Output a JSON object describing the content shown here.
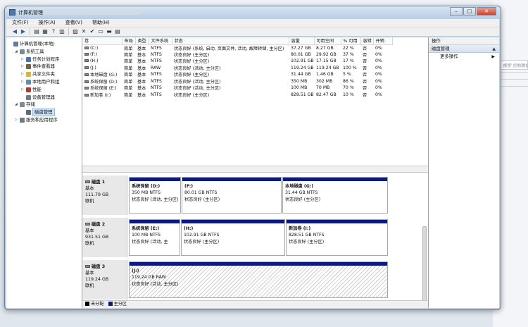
{
  "window": {
    "title": "计算机管理"
  },
  "menu": [
    "文件(F)",
    "操作(A)",
    "查看(V)",
    "帮助(H)"
  ],
  "toolbar_icons": [
    "back-arrow-icon",
    "forward-arrow-icon",
    "folder-up-icon",
    "show-hide-tree-icon",
    "help-icon",
    "properties-icon",
    "delete-icon",
    "check-icon",
    "open-folder-icon",
    "folder-icon",
    "export-list-icon"
  ],
  "tree": [
    {
      "label": "计算机管理(本地)",
      "level": 0,
      "arrow": "",
      "icon": "computer-management-icon",
      "color": "#5b7fa8"
    },
    {
      "label": "系统工具",
      "level": 1,
      "arrow": "▲",
      "icon": "tools-icon",
      "color": "#7a8b8f"
    },
    {
      "label": "任务计划程序",
      "level": 2,
      "arrow": "▸",
      "icon": "clock-icon",
      "color": "#3f77b9"
    },
    {
      "label": "事件查看器",
      "level": 2,
      "arrow": "▸",
      "icon": "event-viewer-icon",
      "color": "#7f5f3b"
    },
    {
      "label": "共享文件夹",
      "level": 2,
      "arrow": "▸",
      "icon": "shared-folder-icon",
      "color": "#d9b33c"
    },
    {
      "label": "本地用户和组",
      "level": 2,
      "arrow": "▸",
      "icon": "users-icon",
      "color": "#5a8cc6"
    },
    {
      "label": "性能",
      "level": 2,
      "arrow": "▸",
      "icon": "performance-icon",
      "color": "#b03a2e"
    },
    {
      "label": "设备管理器",
      "level": 2,
      "arrow": "",
      "icon": "device-manager-icon",
      "color": "#6b7d8e"
    },
    {
      "label": "存储",
      "level": 1,
      "arrow": "▲",
      "icon": "storage-icon",
      "color": "#7a8b8f"
    },
    {
      "label": "磁盘管理",
      "level": 2,
      "arrow": "",
      "icon": "disk-management-icon",
      "color": "#5b6b7c",
      "selected": true
    },
    {
      "label": "服务和应用程序",
      "level": 1,
      "arrow": "▸",
      "icon": "services-icon",
      "color": "#6b7d8e"
    }
  ],
  "volume_table": {
    "columns": [
      "卷",
      "布局",
      "类型",
      "文件系统",
      "状态",
      "容量",
      "可用空间",
      "% 可用",
      "容错",
      "开销"
    ],
    "rows": [
      [
        "(C:)",
        "简单",
        "基本",
        "NTFS",
        "状态良好 (系统, 启动, 页面文件, 活动, 故障转储, 主分区)",
        "37.27 GB",
        "8.27 GB",
        "22 %",
        "否",
        "0%"
      ],
      [
        "(F:)",
        "简单",
        "基本",
        "NTFS",
        "状态良好 (主分区)",
        "80.01 GB",
        "29.92 GB",
        "37 %",
        "否",
        "0%"
      ],
      [
        "(H:)",
        "简单",
        "基本",
        "NTFS",
        "状态良好 (主分区)",
        "102.91 GB",
        "17.15 GB",
        "17 %",
        "否",
        "0%"
      ],
      [
        "(J:)",
        "简单",
        "基本",
        "RAW",
        "状态良好 (活动, 主分区)",
        "119.24 GB",
        "119.24 GB",
        "100 %",
        "否",
        "0%"
      ],
      [
        "本地磁盘 (G:)",
        "简单",
        "基本",
        "NTFS",
        "状态良好 (主分区)",
        "31.44 GB",
        "1.46 GB",
        "5 %",
        "否",
        "0%"
      ],
      [
        "系统保留 (D:)",
        "简单",
        "基本",
        "NTFS",
        "状态良好 (活动, 主分区)",
        "350 MB",
        "302 MB",
        "86 %",
        "否",
        "0%"
      ],
      [
        "系统保留 (E:)",
        "简单",
        "基本",
        "NTFS",
        "状态良好 (活动, 主分区)",
        "100 MB",
        "70 MB",
        "70 %",
        "否",
        "0%"
      ],
      [
        "新加卷 (I:)",
        "简单",
        "基本",
        "NTFS",
        "状态良好 (主分区)",
        "828.51 GB",
        "82.47 GB",
        "10 %",
        "否",
        "0%"
      ]
    ]
  },
  "disks": [
    {
      "name": "磁盘 1",
      "type": "基本",
      "size": "111.79 GB",
      "status": "联机",
      "partitions": [
        {
          "label": "系统保留 (D:)",
          "size": "350 MB NTFS",
          "status": "状态良好 (活动, 主分区)"
        },
        {
          "label": "(F:)",
          "size": "80.01 GB NTFS",
          "status": "状态良好 (主分区)"
        },
        {
          "label": "本地磁盘 (G:)",
          "size": "31.44 GB NTFS",
          "status": "状态良好 (主分区)"
        }
      ]
    },
    {
      "name": "磁盘 2",
      "type": "基本",
      "size": "931.51 GB",
      "status": "联机",
      "partitions": [
        {
          "label": "系统保留 (E:)",
          "size": "100 MB NTFS",
          "status": "状态良好 (活动, 主"
        },
        {
          "label": "(H:)",
          "size": "102.91 GB NTFS",
          "status": "状态良好 (主分区)"
        },
        {
          "label": "新加卷 (I:)",
          "size": "828.51 GB NTFS",
          "status": "状态良好 (主分区)"
        }
      ]
    },
    {
      "name": "磁盘 3",
      "type": "基本",
      "size": "119.24 GB",
      "status": "联机",
      "partitions": [
        {
          "label": "(J:)",
          "size": "119.24 GB RAW",
          "status": "状态良好 (活动, 主分区)"
        }
      ]
    }
  ],
  "legend": [
    {
      "label": "未分配",
      "color": "#000000"
    },
    {
      "label": "主分区",
      "color": "#0a1a80"
    }
  ],
  "actions": {
    "header": "操作",
    "section": "磁盘管理",
    "more": "更多操作"
  },
  "background_search": "搜索 控制面板"
}
